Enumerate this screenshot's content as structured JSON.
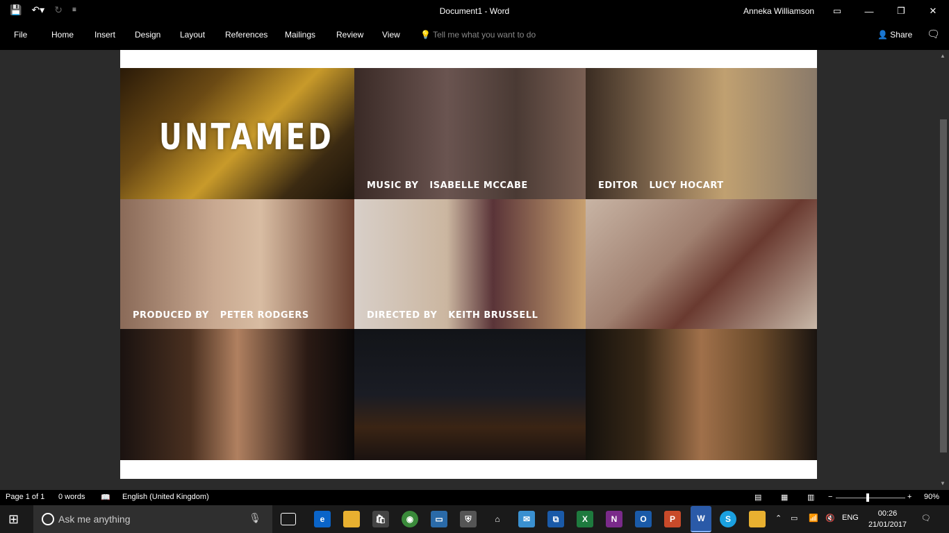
{
  "window": {
    "doc_title": "Document1  -  Word",
    "user": "Anneka Williamson"
  },
  "ribbon": {
    "tabs": [
      "File",
      "Home",
      "Insert",
      "Design",
      "Layout",
      "References",
      "Mailings",
      "Review",
      "View"
    ],
    "tell_me": "Tell me what you want to do",
    "share": "Share"
  },
  "document": {
    "title": "UNTAMED",
    "credits": [
      {
        "role": "MUSIC BY",
        "name": "ISABELLE MCCABE"
      },
      {
        "role": "EDITOR",
        "name": "LUCY HOCART"
      },
      {
        "role": "PRODUCED BY",
        "name": "PETER RODGERS"
      },
      {
        "role": "DIRECTED BY",
        "name": "KEITH BRUSSELL"
      }
    ]
  },
  "status": {
    "page": "Page 1 of 1",
    "words": "0 words",
    "language": "English (United Kingdom)",
    "zoom": "90%"
  },
  "taskbar": {
    "search_placeholder": "Ask me anything",
    "lang": "ENG",
    "time": "00:26",
    "date": "21/01/2017"
  },
  "colors": {
    "titlebar": "#000000",
    "page": "#ffffff",
    "canvas": "#2b2b2b"
  }
}
